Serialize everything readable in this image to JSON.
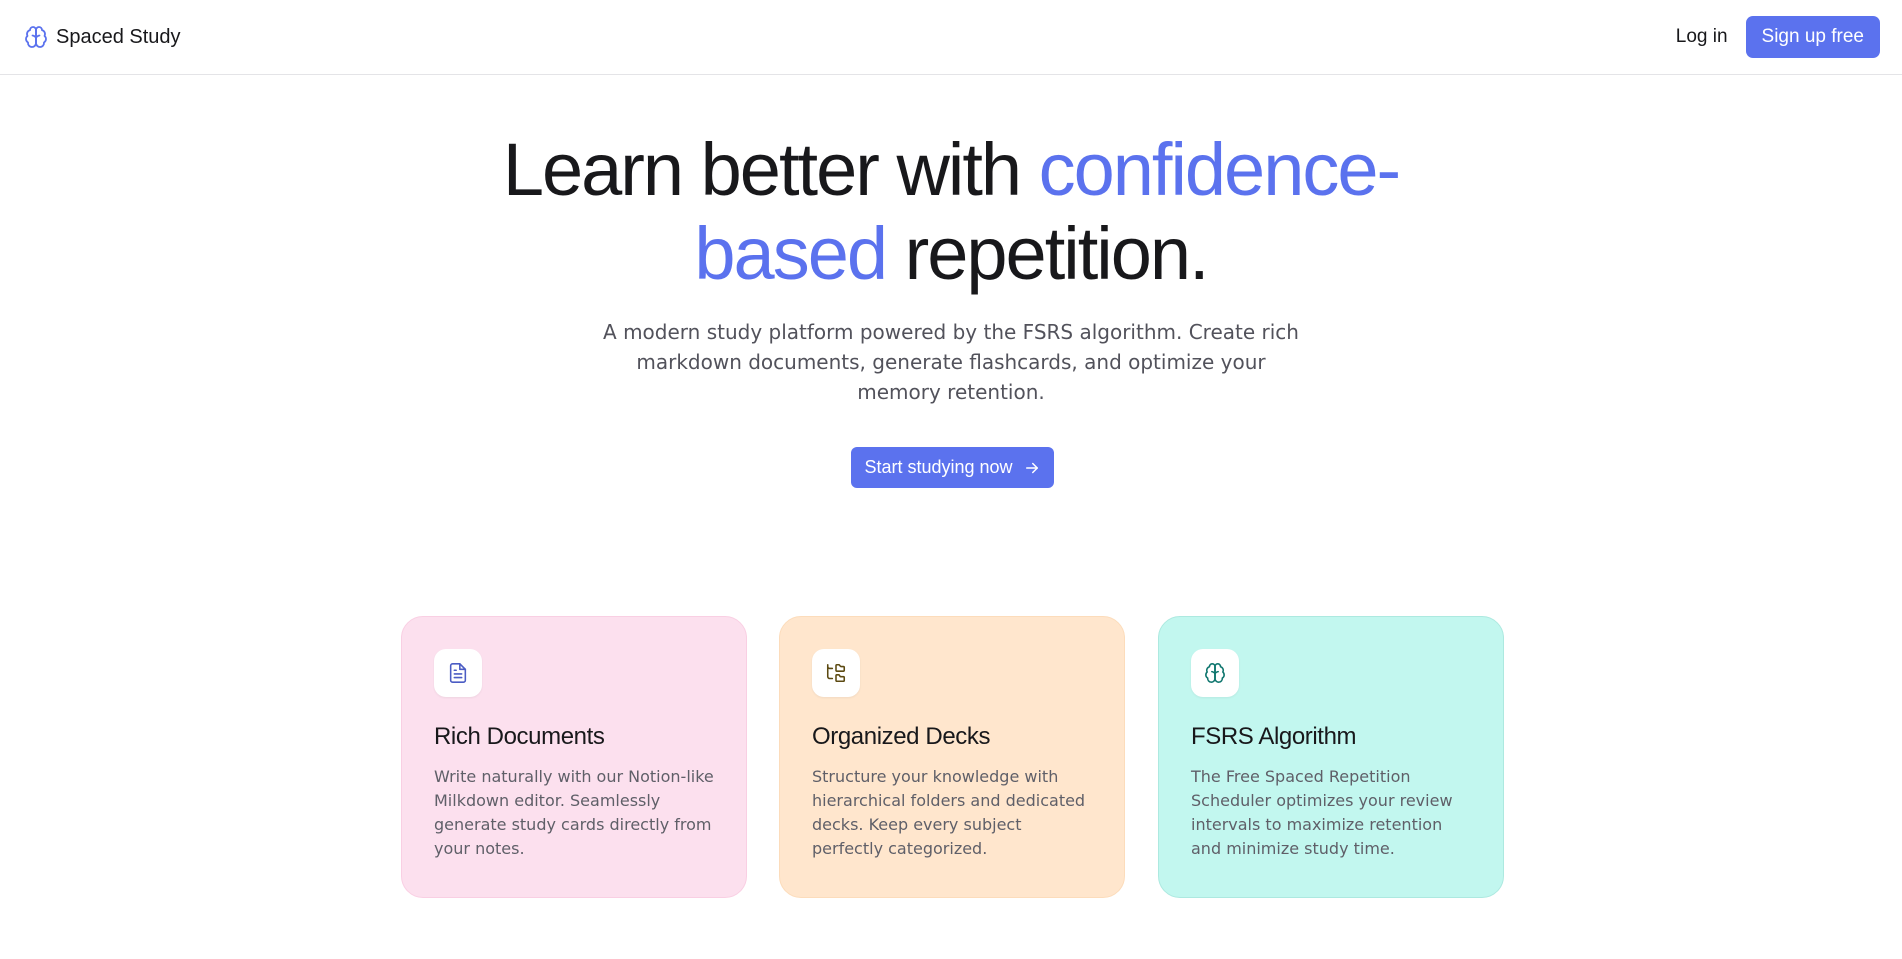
{
  "navbar": {
    "brand_icon": "brain-icon",
    "brand_name": "Spaced Study",
    "login_label": "Log in",
    "signup_label": "Sign up free"
  },
  "colors": {
    "accent": "#5b72ee",
    "card_pink": "#fce0ee",
    "card_orange": "#ffe6cd",
    "card_teal": "#c2f7ef"
  },
  "hero": {
    "title_part1": "Learn better with ",
    "title_accent": "confidence-based",
    "title_part2": " repetition.",
    "subtitle": "A modern study platform powered by the FSRS algorithm. Create rich markdown documents, generate flashcards, and optimize your memory retention.",
    "cta_label": "Start studying now",
    "cta_icon": "arrow-right-icon"
  },
  "features": [
    {
      "icon": "document-icon",
      "title": "Rich Documents",
      "text": "Write naturally with our Notion-like Milkdown editor. Seamlessly generate study cards directly from your notes."
    },
    {
      "icon": "folder-tree-icon",
      "title": "Organized Decks",
      "text": "Structure your knowledge with hierarchical folders and dedicated decks. Keep every subject perfectly categorized."
    },
    {
      "icon": "brain-icon",
      "title": "FSRS Algorithm",
      "text": "The Free Spaced Repetition Scheduler optimizes your review intervals to maximize retention and minimize study time."
    }
  ]
}
